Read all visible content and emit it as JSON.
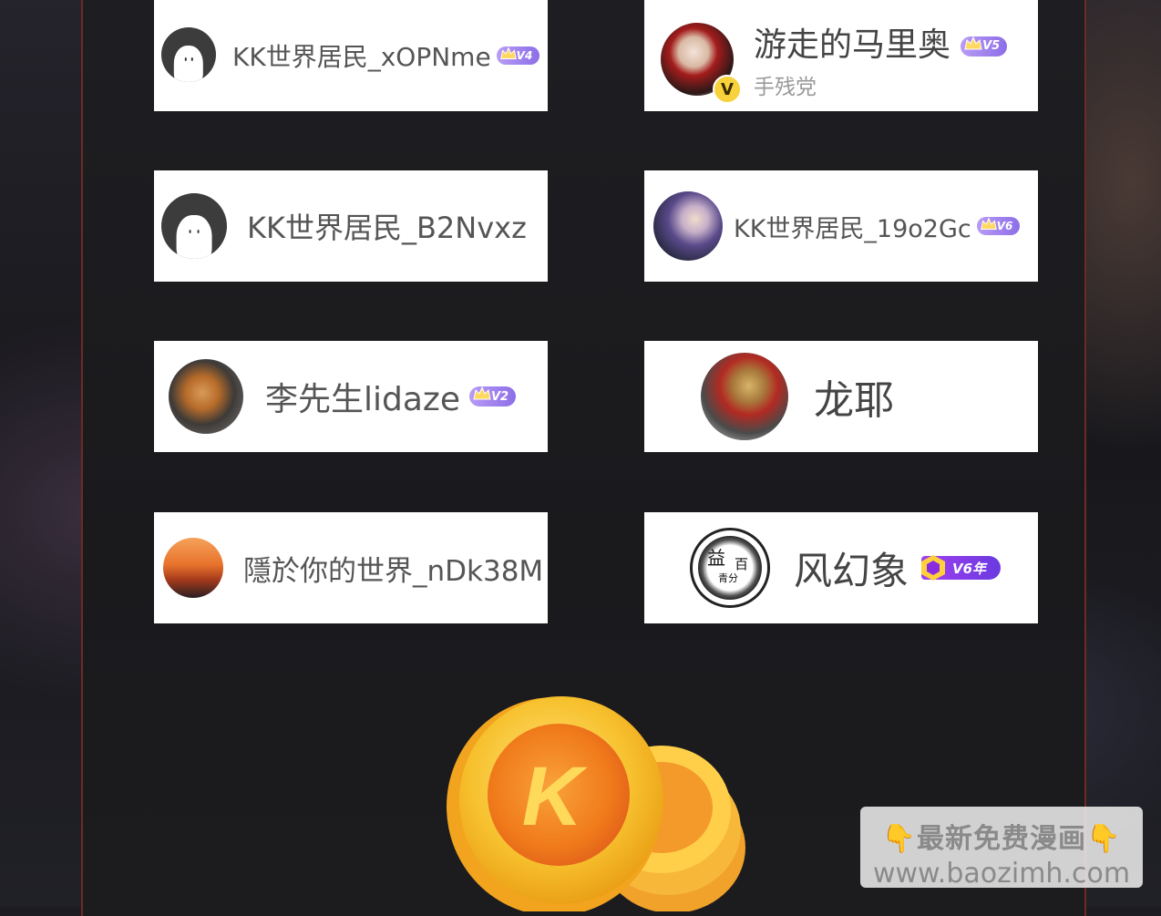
{
  "users": [
    {
      "name": "KK世界居民_xOPNme",
      "level": "V4"
    },
    {
      "name": "游走的马里奥",
      "level": "V5",
      "tag": "手残党",
      "verified": "V"
    },
    {
      "name": "KK世界居民_B2Nvxz"
    },
    {
      "name": "KK世界居民_19o2Gc",
      "level": "V6"
    },
    {
      "name": "李先生lidaze",
      "level": "V2"
    },
    {
      "name": "龙耶"
    },
    {
      "name": "隱於你的世界_nDk38M"
    },
    {
      "name": "风幻象",
      "level": "V6年"
    }
  ],
  "avatar_texts": {
    "calligraphy_1": "益",
    "calligraphy_2": "百",
    "calligraphy_3": "青分"
  },
  "coin": {
    "letter": "K"
  },
  "watermark": {
    "line1": "👇最新免费漫画👇",
    "line2": "www.baozimh.com"
  },
  "colors": {
    "frame_border": "#6e2a22",
    "badge_purple": "#8c6ee8",
    "coin_orange": "#f07a1a",
    "coin_yellow": "#f7c12e"
  }
}
